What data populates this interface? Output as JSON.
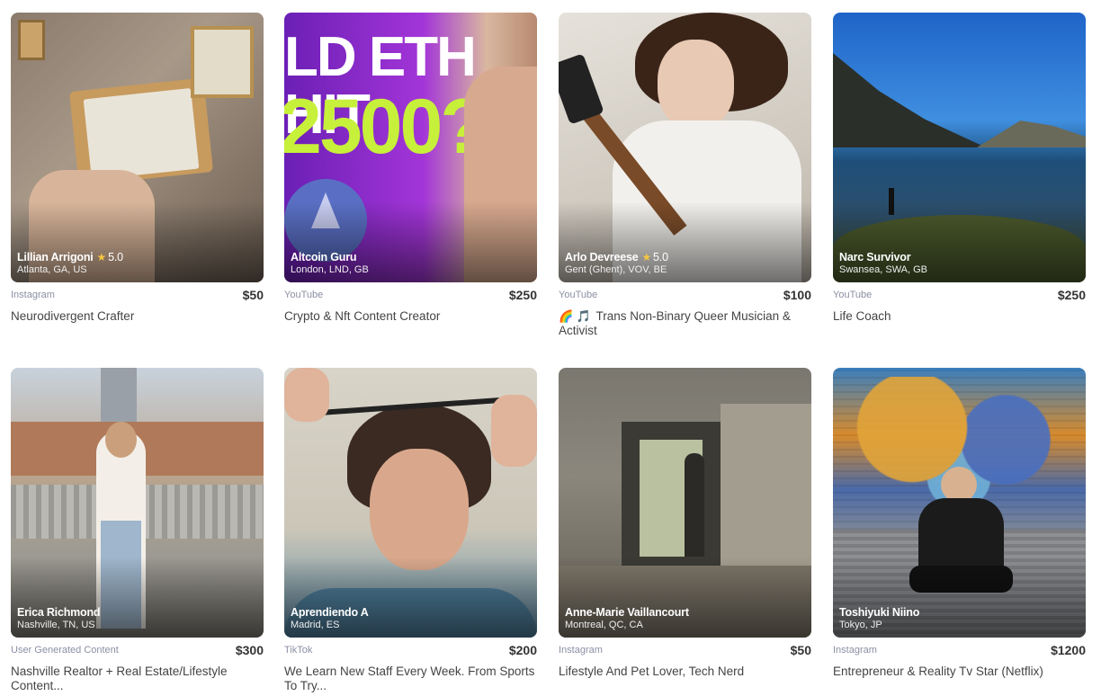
{
  "cards": [
    {
      "name": "Lillian Arrigoni",
      "rating": "5.0",
      "location": "Atlanta, GA, US",
      "platform": "Instagram",
      "price": "$50",
      "title": "Neurodivergent Crafter"
    },
    {
      "name": "Altcoin Guru",
      "rating": "",
      "location": "London, LND, GB",
      "platform": "YouTube",
      "price": "$250",
      "title": "Crypto & Nft Content Creator",
      "thumb_text": "LD ETH HIT\n2500?"
    },
    {
      "name": "Arlo Devreese",
      "rating": "5.0",
      "location": "Gent (Ghent), VOV, BE",
      "platform": "YouTube",
      "price": "$100",
      "title": "Trans Non-Binary Queer Musician & Activist",
      "emoji": "🌈 🎵"
    },
    {
      "name": "Narc Survivor",
      "rating": "",
      "location": "Swansea, SWA, GB",
      "platform": "YouTube",
      "price": "$250",
      "title": "Life Coach"
    },
    {
      "name": "Erica Richmond",
      "rating": "",
      "location": "Nashville, TN, US",
      "platform": "User Generated Content",
      "price": "$300",
      "title": "Nashville Realtor + Real Estate/Lifestyle Content..."
    },
    {
      "name": "Aprendiendo A",
      "rating": "",
      "location": "Madrid, ES",
      "platform": "TikTok",
      "price": "$200",
      "title": "We Learn New Staff Every Week. From Sports To Try..."
    },
    {
      "name": "Anne-Marie Vaillancourt",
      "rating": "",
      "location": "Montreal, QC, CA",
      "platform": "Instagram",
      "price": "$50",
      "title": "Lifestyle And Pet Lover, Tech Nerd"
    },
    {
      "name": "Toshiyuki Niino",
      "rating": "",
      "location": "Tokyo, JP",
      "platform": "Instagram",
      "price": "$1200",
      "title": "Entrepreneur & Reality Tv Star (Netflix)"
    }
  ],
  "icons": {
    "rating": "star-icon"
  },
  "colors": {
    "star": "#f5c542",
    "platform_text": "#8b8fa3",
    "price_text": "#333333"
  }
}
